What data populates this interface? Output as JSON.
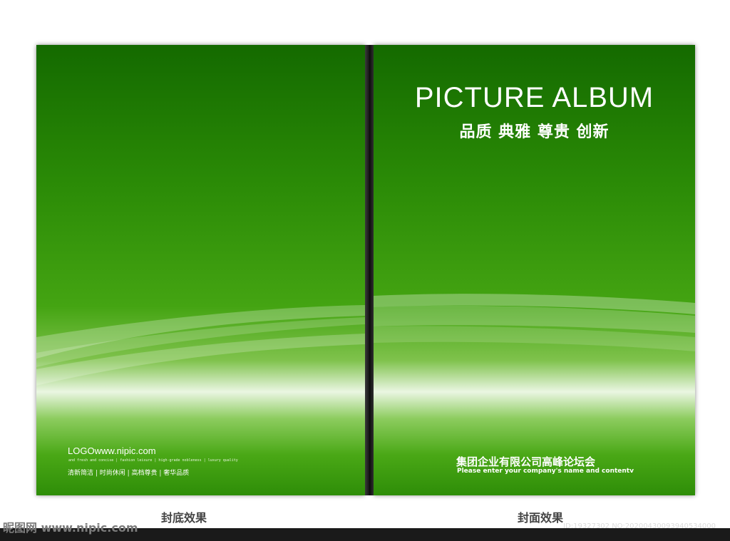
{
  "front_cover": {
    "title": "PICTURE ALBUM",
    "tagline": "品质 典雅 尊贵 创新",
    "company_name": "集团企业有限公司高峰论坛会",
    "company_sub": "Please enter your company's name and contentv"
  },
  "back_cover": {
    "logo_text": "LOGOwww.nipic.com",
    "english_line": "and fresh and concise | fashion leisure | high-grade nobleness | luxury quality",
    "chinese_line": "清新简洁 | 时尚休闲 | 高档尊贵 | 奢华品质"
  },
  "labels": {
    "back": "封底效果",
    "front": "封面效果"
  },
  "watermark": {
    "site": "昵图网 www.nipic.com",
    "id_text": "ID:19327302 NO:20200430093940534000"
  },
  "colors": {
    "cover_green": "#2a8a06",
    "spine": "#1a1a1a"
  }
}
